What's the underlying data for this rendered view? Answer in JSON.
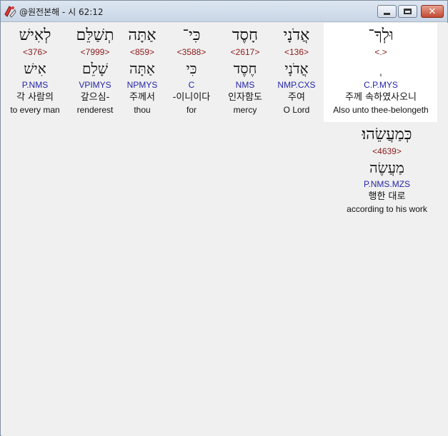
{
  "window": {
    "title": "@원전본해 - 시 62:12",
    "controls": {
      "minimize": "minimize",
      "maximize": "maximize",
      "close": "✕"
    }
  },
  "words": [
    {
      "hebrew": "לְאִישׁ",
      "strong": "<376>",
      "lemma": "אִישׁ",
      "morph": "P.NMS",
      "korean": "각 사람의",
      "english": "to every man"
    },
    {
      "hebrew": "תְשַׁלֵּם",
      "strong": "<7999>",
      "lemma": "שָׁלֵם",
      "morph": "VPIMYS",
      "korean": "갚으심-",
      "english": "renderest"
    },
    {
      "hebrew": "אַתָּה",
      "strong": "<859>",
      "lemma": "אַתָּה",
      "morph": "NPMYS",
      "korean": "주께서",
      "english": "thou"
    },
    {
      "hebrew": "כִּי־",
      "strong": "<3588>",
      "lemma": "כִּי",
      "morph": "C",
      "korean": "-이니이다",
      "english": "for"
    },
    {
      "hebrew": "חָסֶד",
      "strong": "<2617>",
      "lemma": "חֶסֶד",
      "morph": "NMS",
      "korean": "인자함도",
      "english": "mercy"
    },
    {
      "hebrew": "אֲדֹנָי",
      "strong": "<136>",
      "lemma": "אֲדֹנָי",
      "morph": "NMP.CXS",
      "korean": "주여",
      "english": "O Lord"
    },
    {
      "hebrew": "וּלְךָ־",
      "strong": "<.>",
      "lemma": "ְ",
      "morph": "C.P.MYS",
      "korean": "주께 속하였사오니",
      "english": "Also unto thee-belongeth"
    },
    {
      "hebrew": "כְּמַעֲשֵׂהוּ׃",
      "strong": "<4639>",
      "lemma": "מַעֲשֶׂה",
      "morph": "P.NMS.MZS",
      "korean": "행한 대로",
      "english": "according to his work"
    }
  ]
}
